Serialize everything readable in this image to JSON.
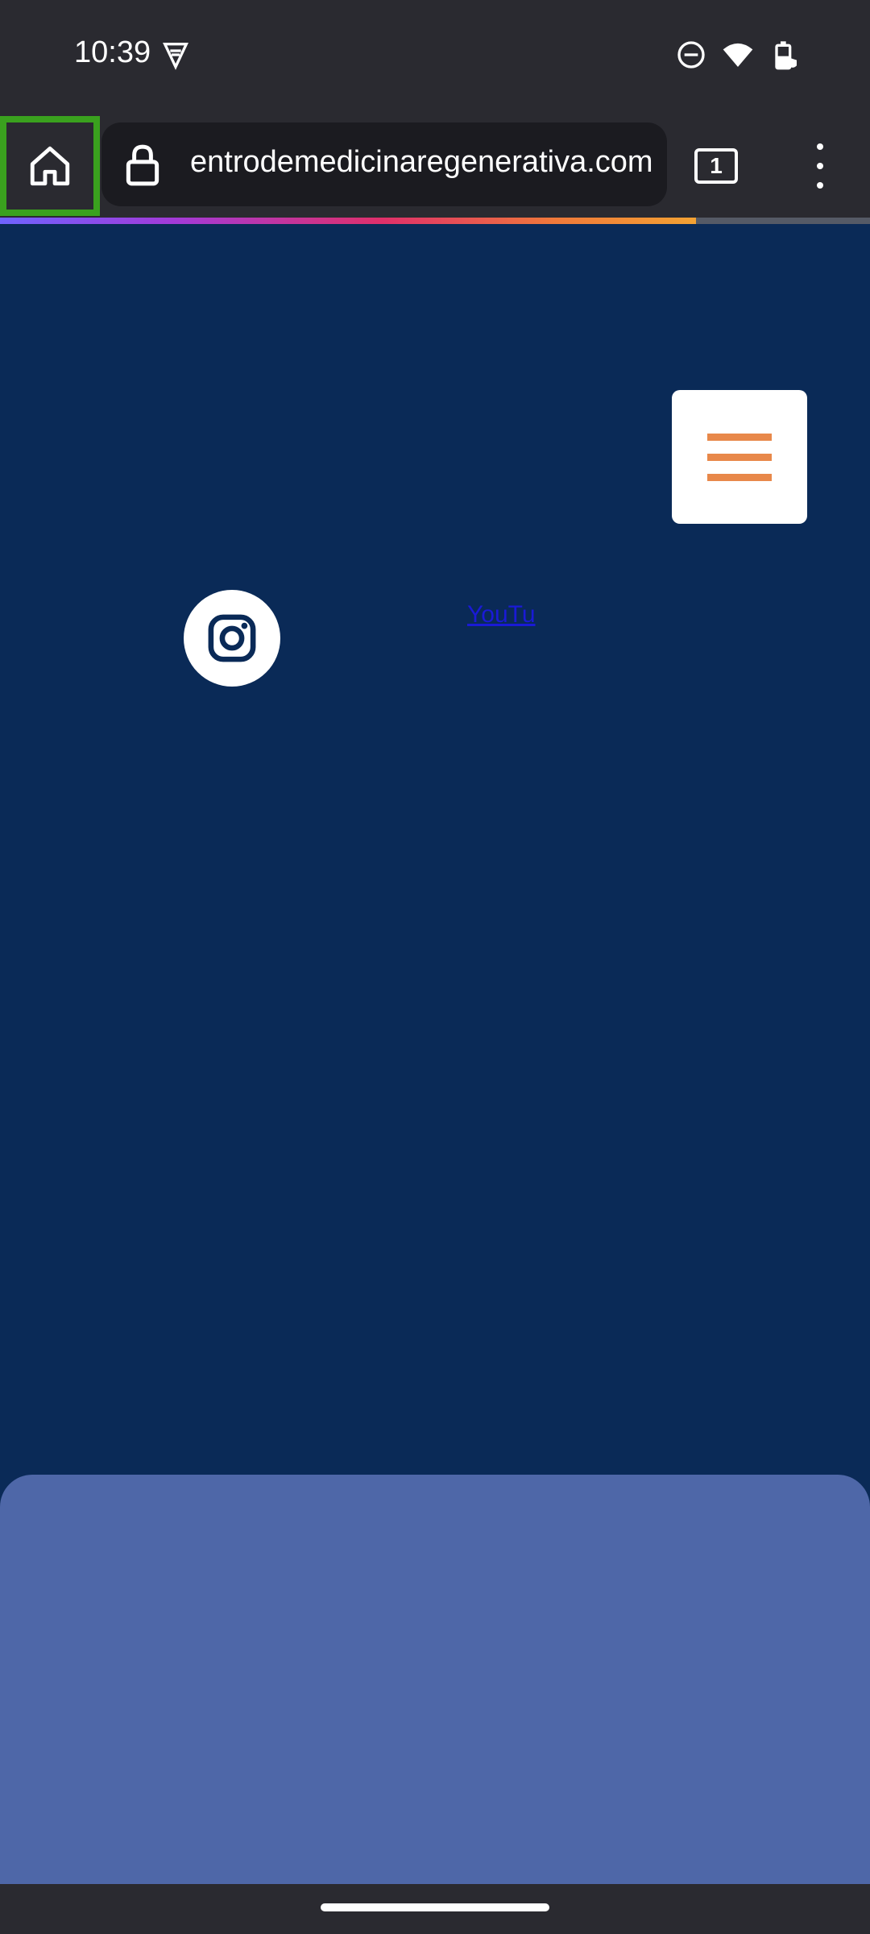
{
  "status_bar": {
    "time": "10:39"
  },
  "browser": {
    "url": "entrodemedicinaregenerativa.com",
    "tab_count": "1",
    "progress": 0.8
  },
  "page": {
    "youtube_link_text": "YouTu"
  },
  "icons": {
    "home": "home-icon",
    "lock": "lock-icon",
    "menu": "more-vert-icon",
    "hamburger": "hamburger-menu-icon",
    "instagram": "instagram-icon"
  },
  "colors": {
    "page_bg": "#0a2a57",
    "hamburger_lines": "#e8884a",
    "bottom_panel": "#4e67a8",
    "highlight": "#3aa11e"
  }
}
